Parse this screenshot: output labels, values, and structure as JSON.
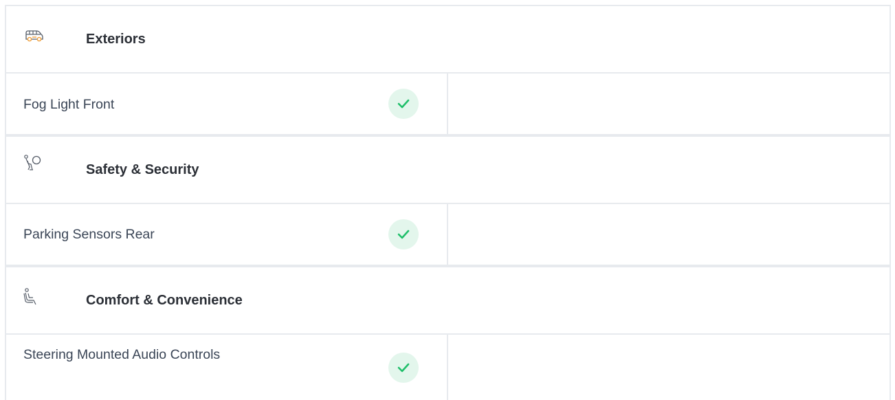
{
  "sections": [
    {
      "icon": "car-icon",
      "title": "Exteriors",
      "features": [
        {
          "name": "Fog Light Front",
          "available": true
        }
      ]
    },
    {
      "icon": "airbag-icon",
      "title": "Safety & Security",
      "features": [
        {
          "name": "Parking Sensors Rear",
          "available": true
        }
      ]
    },
    {
      "icon": "seat-icon",
      "title": "Comfort & Convenience",
      "features": [
        {
          "name": "Steering Mounted Audio Controls",
          "available": true
        }
      ]
    }
  ],
  "colors": {
    "check_bg": "#e3f6ec",
    "check_mark": "#1fbf6a",
    "icon_orange": "#f0a03c",
    "border": "#e7eaee"
  }
}
